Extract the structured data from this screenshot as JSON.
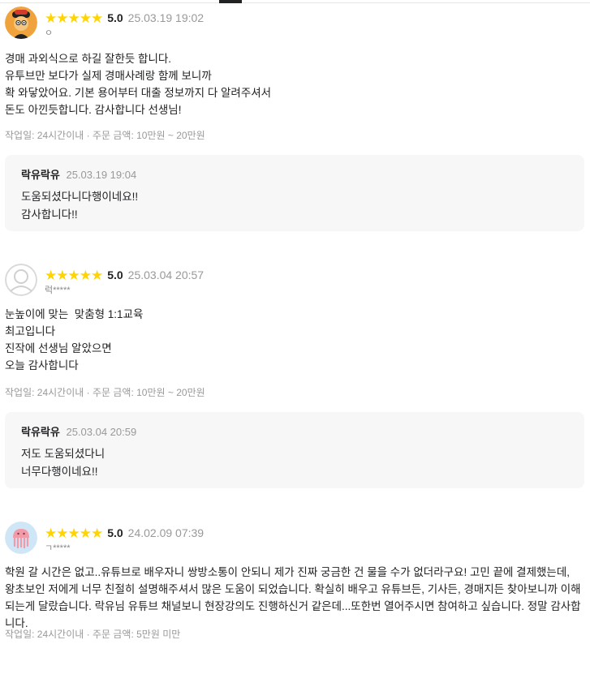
{
  "reviews": [
    {
      "rating": "5.0",
      "date": "25.03.19 19:02",
      "nickname": "ㅇ",
      "avatar_icon": "cartoon-avatar-icon",
      "lines": [
        "경매 과외식으로 하길 잘한듯 합니다.",
        "유투브만 보다가 실제 경매사례랑 함께 보니까",
        "확 와닿았어요. 기본 용어부터 대출 정보까지 다 알려주셔서",
        "돈도 아낀듯합니다. 감사합니다 선생님!"
      ],
      "meta": "작업일: 24시간이내 · 주문 금액: 10만원 ~ 20만원",
      "reply": {
        "name": "락유락유",
        "date": "25.03.19 19:04",
        "lines": [
          "도움되셨다니다행이네요!!",
          "감사합니다!!"
        ]
      }
    },
    {
      "rating": "5.0",
      "date": "25.03.04 20:57",
      "nickname": "럭*****",
      "avatar_icon": "default-user-icon",
      "lines": [
        "눈높이에 맞는  맞춤형 1:1교육",
        "최고입니다",
        "진작에 선생님 알았으면",
        "오늘 감사합니다"
      ],
      "meta": "작업일: 24시간이내 · 주문 금액: 10만원 ~ 20만원",
      "reply": {
        "name": "락유락유",
        "date": "25.03.04 20:59",
        "lines": [
          "저도 도움되셨다니",
          "너무다행이네요!!"
        ]
      }
    },
    {
      "rating": "5.0",
      "date": "24.02.09 07:39",
      "nickname": "ㄱ*****",
      "avatar_icon": "jellyfish-avatar-icon",
      "lines": [
        "학원 갈 시간은 없고..유튜브로 배우자니 쌍방소통이 안되니 제가 진짜 궁금한 건 물을 수가 없더라구요! 고민 끝에 결제했는데, 왕초보인 저에게 너무 친절히 설명해주셔서 많은 도움이 되었습니다. 확실히 배우고 유튜브든, 기사든, 경매지든 찾아보니까 이해되는게 달랐습니다. 락유님 유튜브 채널보니 현장강의도 진행하신거 같은데...또한번 열어주시면 참여하고 싶습니다. 정말 감사합니다."
      ],
      "meta": "작업일: 24시간이내 · 주문 금액: 5만원 미만"
    }
  ],
  "colors": {
    "star": "#ffd400",
    "muted": "#999999",
    "reply_bg": "#f7f7f8",
    "text": "#212224"
  }
}
